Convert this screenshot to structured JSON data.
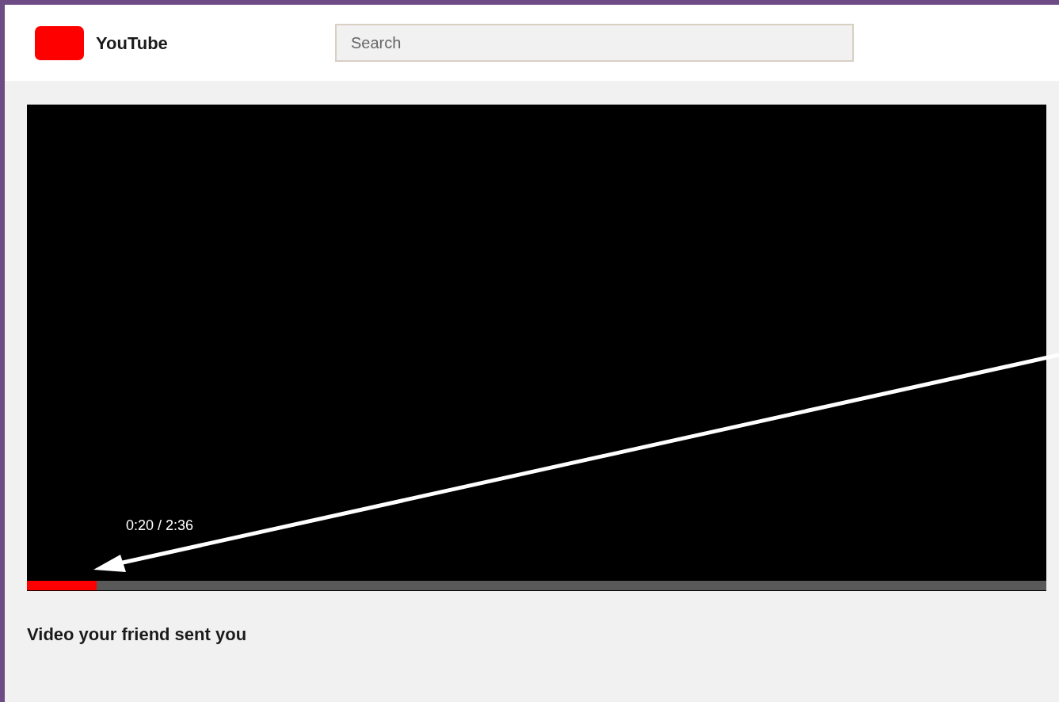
{
  "header": {
    "logo_text": "YouTube",
    "search": {
      "placeholder": "Search"
    }
  },
  "video": {
    "time": "0:20 / 2:36",
    "progress": {
      "level": 0.068
    }
  },
  "title": "Video your friend sent you"
}
